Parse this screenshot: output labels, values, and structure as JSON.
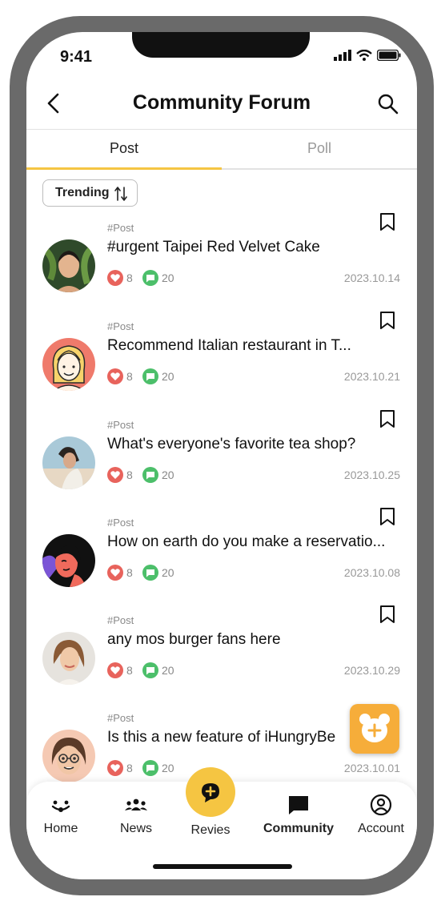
{
  "status_bar": {
    "time": "9:41"
  },
  "header": {
    "title": "Community Forum"
  },
  "tabs": [
    {
      "label": "Post",
      "active": true
    },
    {
      "label": "Poll",
      "active": false
    }
  ],
  "sort_button": {
    "label": "Trending"
  },
  "posts": [
    {
      "tag": "#Post",
      "title": "#urgent Taipei Red Velvet Cake",
      "likes": "8",
      "comments": "20",
      "date": "2023.10.14"
    },
    {
      "tag": "#Post",
      "title": "Recommend Italian restaurant in T...",
      "likes": "8",
      "comments": "20",
      "date": "2023.10.21"
    },
    {
      "tag": "#Post",
      "title": "What's everyone's favorite tea shop?",
      "likes": "8",
      "comments": "20",
      "date": "2023.10.25"
    },
    {
      "tag": "#Post",
      "title": "How on earth do you make a reservatio...",
      "likes": "8",
      "comments": "20",
      "date": "2023.10.08"
    },
    {
      "tag": "#Post",
      "title": "any mos burger fans here",
      "likes": "8",
      "comments": "20",
      "date": "2023.10.29"
    },
    {
      "tag": "#Post",
      "title": "Is this a new feature of iHungryBe",
      "likes": "8",
      "comments": "20",
      "date": "2023.10.01"
    }
  ],
  "bottom_nav": [
    {
      "label": "Home",
      "icon": "home-icon"
    },
    {
      "label": "News",
      "icon": "people-icon"
    },
    {
      "label": "Revies",
      "icon": "chat-plus-icon"
    },
    {
      "label": "Community",
      "icon": "message-icon",
      "active": true
    },
    {
      "label": "Account",
      "icon": "user-icon"
    }
  ],
  "colors": {
    "accent": "#f5c542",
    "fab": "#f6ad3a",
    "like": "#e8635c",
    "comment": "#4cbf6a"
  }
}
